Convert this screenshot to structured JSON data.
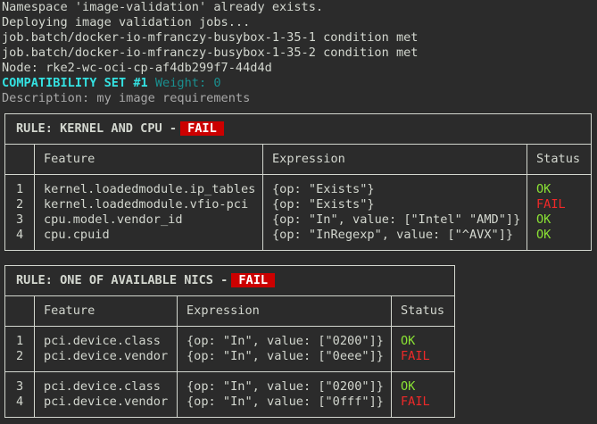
{
  "log_lines": [
    "Namespace 'image-validation' already exists.",
    "Deploying image validation jobs...",
    "job.batch/docker-io-mfranczy-busybox-1-35-1 condition met",
    "job.batch/docker-io-mfranczy-busybox-1-35-2 condition met",
    "Node: rke2-wc-oci-cp-af4db299f7-44d4d"
  ],
  "compat_set": {
    "label": "COMPATIBILITY SET #1",
    "weight": "Weight: 0",
    "description": "Description: my image requirements"
  },
  "rule1": {
    "title": "RULE: KERNEL AND CPU -",
    "badge": "FAIL",
    "headers": [
      "Feature",
      "Expression",
      "Status"
    ],
    "rows": [
      {
        "num": "1",
        "feature": "kernel.loadedmodule.ip_tables",
        "expression": "{op: \"Exists\"}",
        "status": "OK"
      },
      {
        "num": "2",
        "feature": "kernel.loadedmodule.vfio-pci",
        "expression": "{op: \"Exists\"}",
        "status": "FAIL"
      },
      {
        "num": "3",
        "feature": "cpu.model.vendor_id",
        "expression": "{op: \"In\", value: [\"Intel\" \"AMD\"]}",
        "status": "OK"
      },
      {
        "num": "4",
        "feature": "cpu.cpuid",
        "expression": "{op: \"InRegexp\", value: [\"^AVX\"]}",
        "status": "OK"
      }
    ]
  },
  "rule2": {
    "title": "RULE: ONE OF AVAILABLE NICS -",
    "badge": "FAIL",
    "headers": [
      "Feature",
      "Expression",
      "Status"
    ],
    "groups": [
      [
        {
          "num": "1",
          "feature": "pci.device.class",
          "expression": "{op: \"In\", value: [\"0200\"]}",
          "status": "OK"
        },
        {
          "num": "2",
          "feature": "pci.device.vendor",
          "expression": "{op: \"In\", value: [\"0eee\"]}",
          "status": "FAIL"
        }
      ],
      [
        {
          "num": "3",
          "feature": "pci.device.class",
          "expression": "{op: \"In\", value: [\"0200\"]}",
          "status": "OK"
        },
        {
          "num": "4",
          "feature": "pci.device.vendor",
          "expression": "{op: \"In\", value: [\"0fff\"]}",
          "status": "FAIL"
        }
      ]
    ]
  },
  "colors": {
    "background": "#2b2b2b",
    "text": "#d3d7cf",
    "ok": "#8ae234",
    "fail": "#ef2929",
    "fail_badge": "#cc0000",
    "accent_cyan": "#34e2e2"
  }
}
